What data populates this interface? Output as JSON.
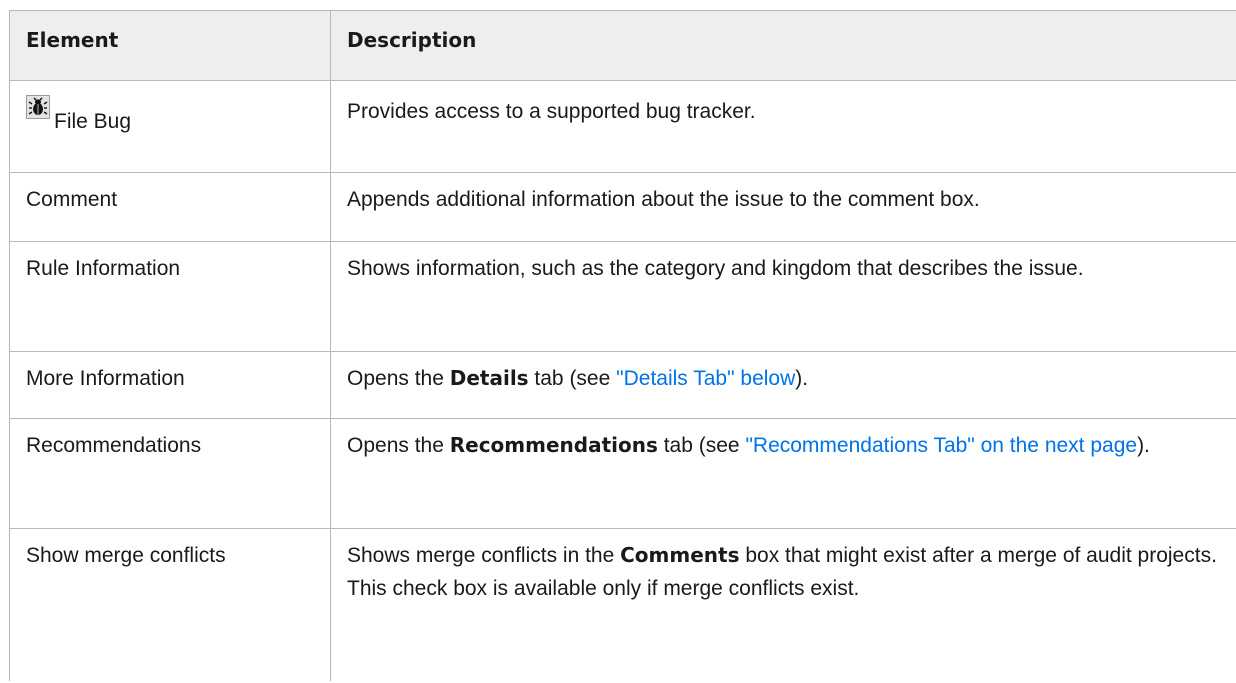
{
  "table": {
    "headers": {
      "element": "Element",
      "description": "Description"
    },
    "rows": [
      {
        "element": "File Bug",
        "element_icon": "bug-icon",
        "description": "Provides access to a supported bug tracker."
      },
      {
        "element": "Comment",
        "description": "Appends additional information about the issue to the comment box."
      },
      {
        "element": "Rule Information",
        "description": "Shows information, such as the category and kingdom that describes the issue."
      },
      {
        "element": "More Information",
        "description_parts": {
          "before": "Opens the ",
          "bold": "Details",
          "middle": " tab (see ",
          "link": "\"Details Tab\" below",
          "after": ")."
        }
      },
      {
        "element": "Recommendations",
        "description_parts": {
          "before": "Opens the ",
          "bold": "Recommendations",
          "middle": " tab (see ",
          "link": "\"Recommendations Tab\" on the next page",
          "after": ")."
        }
      },
      {
        "element": "Show merge conflicts",
        "description_parts": {
          "before": "Shows merge conflicts in the ",
          "bold": "Comments",
          "after": " box that might exist after a merge of audit projects. This check box is available only if merge conflicts exist."
        }
      }
    ]
  },
  "colors": {
    "link": "#0073e7",
    "header_bg": "#eeeeee",
    "border": "#b8b8b8"
  }
}
